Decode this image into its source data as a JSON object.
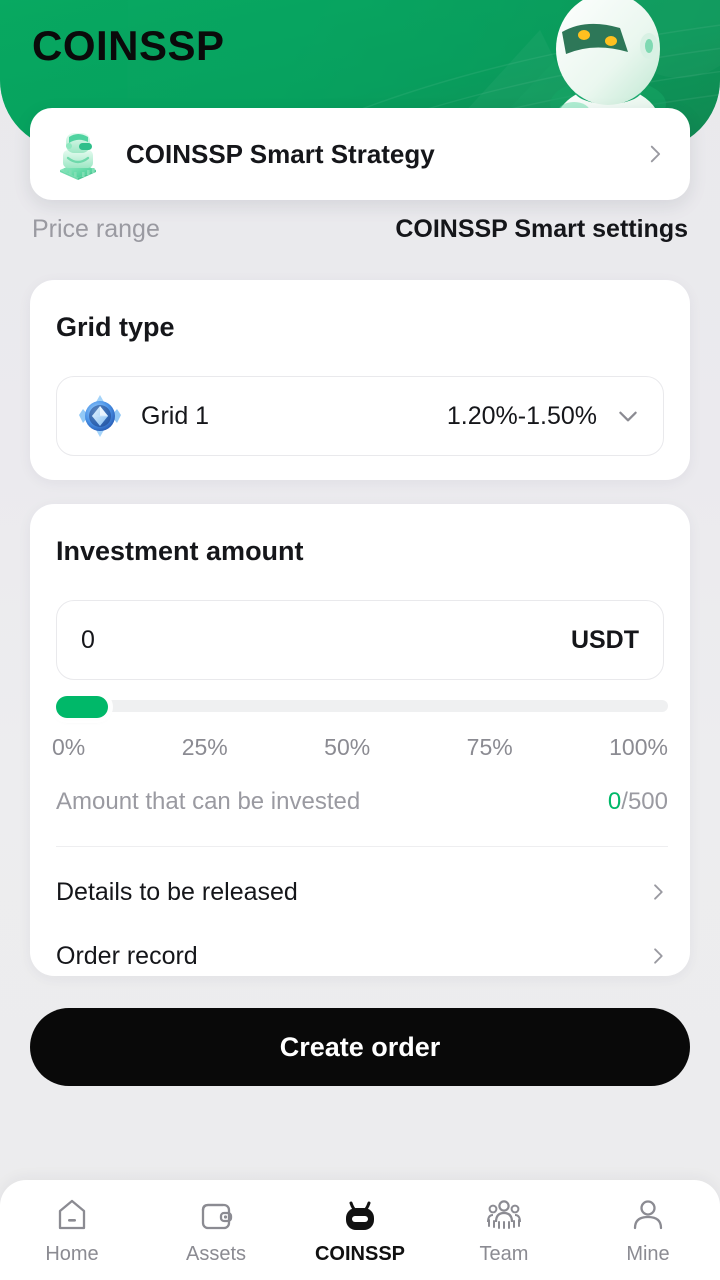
{
  "header": {
    "app_title": "COINSSP",
    "robot_icon": "robot-mascot-illustration",
    "brand_green": "#07a861",
    "brand_green_dark": "#138f55"
  },
  "strategy_card": {
    "icon": "green-robot-chip-icon",
    "label": "COINSSP Smart Strategy",
    "chevron": "chevron-right-icon"
  },
  "tabs": [
    {
      "label": "Price range",
      "active": false
    },
    {
      "label": "COINSSP Smart settings",
      "active": true
    }
  ],
  "grid_card": {
    "title": "Grid type",
    "option": {
      "icon": "blue-gem-badge-icon",
      "name": "Grid 1",
      "rate": "1.20%-1.50%",
      "chevron": "chevron-down-icon"
    }
  },
  "investment_card": {
    "title": "Investment amount",
    "input": {
      "value": "0",
      "placeholder": "0",
      "unit": "USDT"
    },
    "slider": {
      "value_percent": 0,
      "marks": [
        "0%",
        "25%",
        "50%",
        "75%",
        "100%"
      ],
      "fill_color": "#00b869",
      "track_color": "#eff0f1"
    },
    "available": {
      "label": "Amount that can be invested",
      "current": "0",
      "separator": "/",
      "max": "500",
      "current_color": "#00b869"
    },
    "links": [
      {
        "label": "Details to be released",
        "chevron": "chevron-right-icon"
      },
      {
        "label": "Order record",
        "chevron": "chevron-right-icon"
      }
    ]
  },
  "cta": {
    "label": "Create order",
    "background": "#090909"
  },
  "bottom_nav": [
    {
      "label": "Home",
      "icon": "home-icon",
      "active": false
    },
    {
      "label": "Assets",
      "icon": "wallet-icon",
      "active": false
    },
    {
      "label": "COINSSP",
      "icon": "robot-icon",
      "active": true
    },
    {
      "label": "Team",
      "icon": "people-group-icon",
      "active": false
    },
    {
      "label": "Mine",
      "icon": "person-icon",
      "active": false
    }
  ]
}
